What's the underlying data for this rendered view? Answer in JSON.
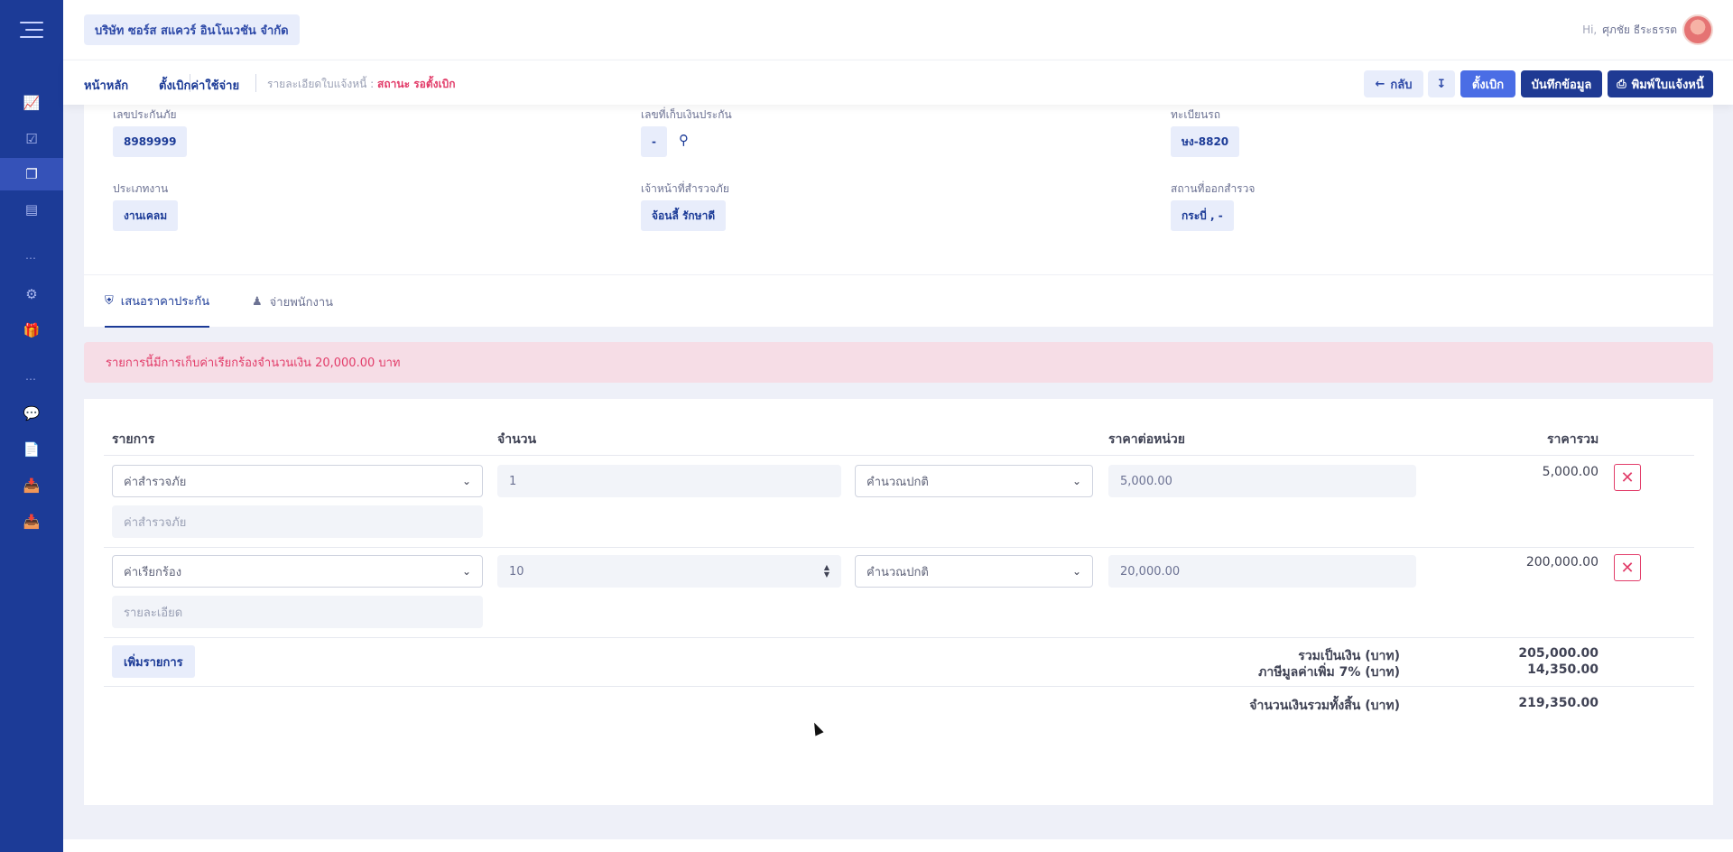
{
  "topbar": {
    "company": "บริษัท ซอร์ส สแควร์ อินโนเวชัน จำกัด",
    "user_hi": "Hi,",
    "user_name": "ศุภชัย ธีระธรรต"
  },
  "subbar": {
    "home": "หน้าหลัก",
    "expense": "ตั้งเบิกค่าใช้จ่าย",
    "detail_label": "รายละเอียดใบแจ้งหนี้ :",
    "status": "สถานะ รอตั้งเบิก",
    "back_label": "กลับ",
    "claim_label": "ตั้งเบิก",
    "save_label": "บันทึกข้อมูล",
    "print_label": "พิมพ์ใบแจ้งหนี้"
  },
  "info": {
    "policy_label": "เลขประกันภัย",
    "policy_value": "8989999",
    "receipt_label": "เลขที่เก็บเงินประกัน",
    "receipt_value": "-",
    "plate_label": "ทะเบียนรถ",
    "plate_value": "ษง-8820",
    "worktype_label": "ประเภทงาน",
    "worktype_value": "งานเคลม",
    "surveyor_label": "เจ้าหน้าที่สำรวจภัย",
    "surveyor_value": "จ้อนลี้ รักษาดี",
    "location_label": "สถานที่ออกสำรวจ",
    "location_value": "กระบี่ , -"
  },
  "tabs": {
    "quote": "เสนอราคาประกัน",
    "pay_staff": "จ่ายพนักงาน"
  },
  "alert": "รายการนี้มีการเก็บค่าเรียกร้องจำนวนเงิน 20,000.00 บาท",
  "table": {
    "headers": {
      "item": "รายการ",
      "qty": "จำนวน",
      "unit_price": "ราคาต่อหน่วย",
      "total": "ราคารวม"
    },
    "rows": [
      {
        "item": "ค่าสำรวจภัย",
        "detail": "ค่าสำรวจภัย",
        "qty": "1",
        "calc": "คำนวณปกติ",
        "unit_price": "5,000.00",
        "total": "5,000.00"
      },
      {
        "item": "ค่าเรียกร้อง",
        "detail": "รายละเอียด",
        "qty": "10",
        "calc": "คำนวณปกติ",
        "unit_price": "20,000.00",
        "total": "200,000.00"
      }
    ],
    "add_label": "เพิ่มรายการ"
  },
  "summary": {
    "subtotal_label": "รวมเป็นเงิน (บาท)",
    "subtotal": "205,000.00",
    "vat_label": "ภาษีมูลค่าเพิ่ม 7% (บาท)",
    "vat": "14,350.00",
    "grand_label": "จำนวนเงินรวมทั้งสิ้น (บาท)",
    "grand": "219,350.00"
  }
}
